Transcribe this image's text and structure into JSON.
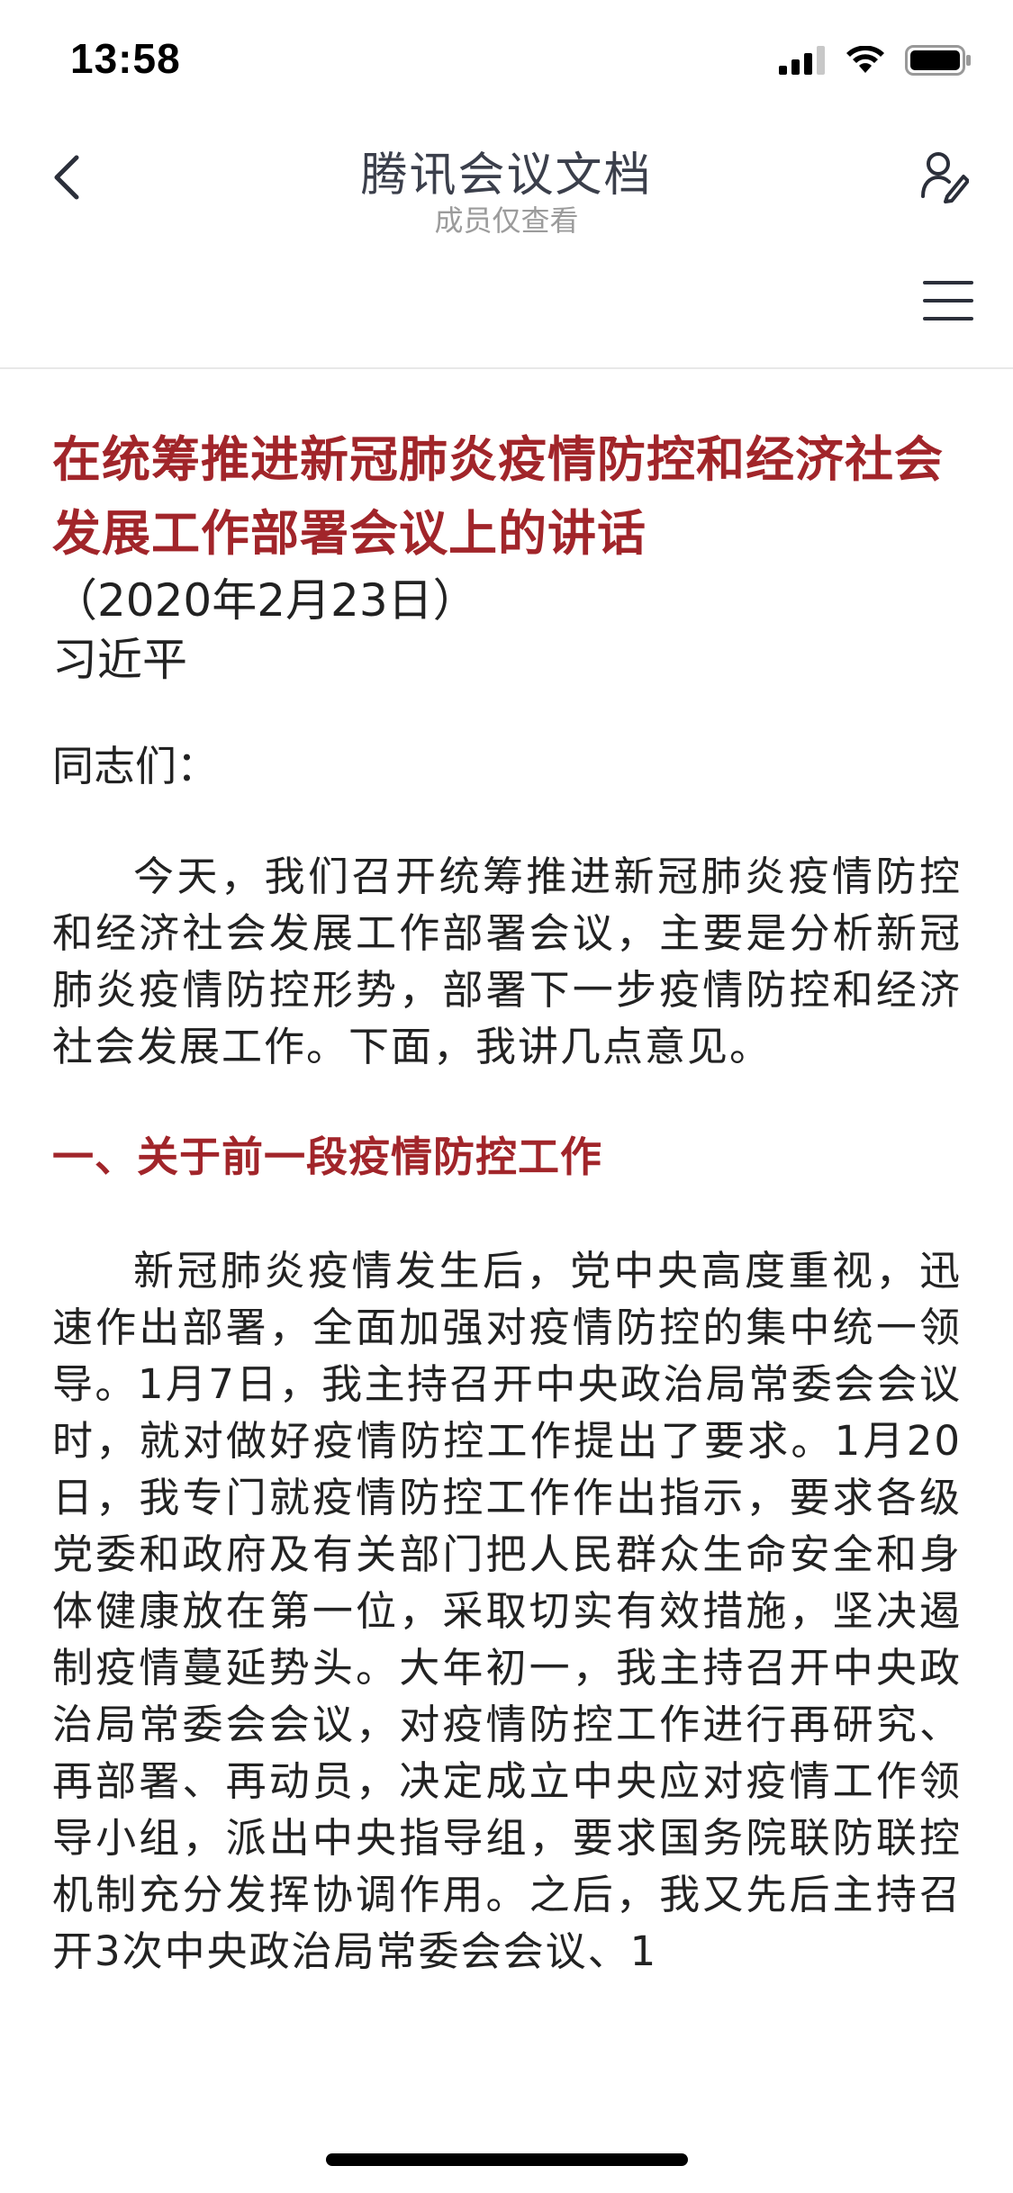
{
  "status_bar": {
    "time": "13:58",
    "icons": [
      "signal-icon",
      "wifi-icon",
      "battery-icon"
    ]
  },
  "nav": {
    "title": "腾讯会议文档",
    "subtitle": "成员仅查看",
    "icons": {
      "back": "chevron-left-icon",
      "members": "member-edit-icon",
      "menu": "hamburger-menu-icon"
    }
  },
  "document": {
    "title": "在统筹推进新冠肺炎疫情防控和经济社会发展工作部署会议上的讲话",
    "date": "（2020年2月23日）",
    "author": "习近平",
    "greeting": "同志们：",
    "paragraphs": [
      "今天，我们召开统筹推进新冠肺炎疫情防控和经济社会发展工作部署会议，主要是分析新冠肺炎疫情防控形势，部署下一步疫情防控和经济社会发展工作。下面，我讲几点意见。"
    ],
    "section_heading": "一、关于前一段疫情防控工作",
    "section_paragraph": "新冠肺炎疫情发生后，党中央高度重视，迅速作出部署，全面加强对疫情防控的集中统一领导。1月7日，我主持召开中央政治局常委会会议时，就对做好疫情防控工作提出了要求。1月20日，我专门就疫情防控工作作出指示，要求各级党委和政府及有关部门把人民群众生命安全和身体健康放在第一位，采取切实有效措施，坚决遏制疫情蔓延势头。大年初一，我主持召开中央政治局常委会会议，对疫情防控工作进行再研究、再部署、再动员，决定成立中央应对疫情工作领导小组，派出中央指导组，要求国务院联防联控机制充分发挥协调作用。之后，我又先后主持召开3次中央政治局常委会会议、1"
  },
  "colors": {
    "accent_red": "#a1252a",
    "title_gray": "#3b3f4b",
    "subtitle_gray": "#9b9b9b"
  }
}
